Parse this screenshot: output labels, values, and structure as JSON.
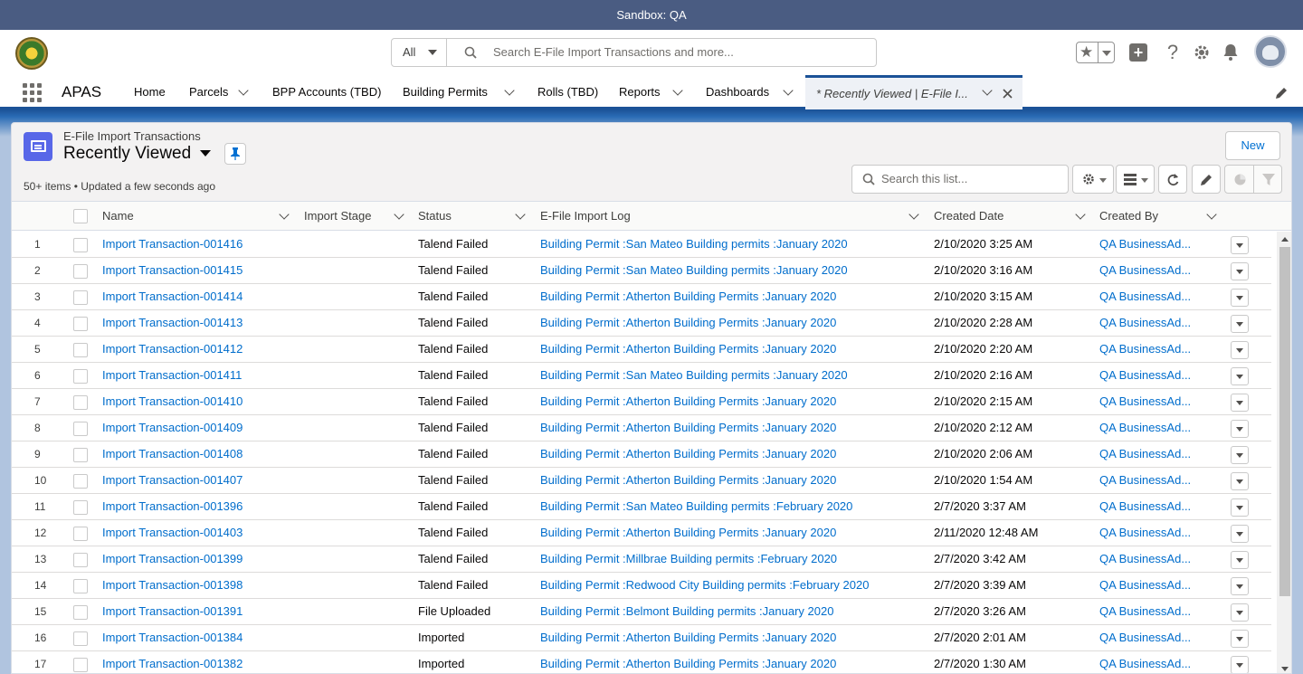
{
  "sandbox": {
    "label": "Sandbox: QA"
  },
  "header": {
    "search_scope": "All",
    "search_placeholder": "Search E-File Import Transactions and more..."
  },
  "nav": {
    "app_name": "APAS",
    "items": [
      {
        "label": "Home"
      },
      {
        "label": "Parcels"
      },
      {
        "label": "BPP Accounts (TBD)"
      },
      {
        "label": "Building Permits"
      },
      {
        "label": "Rolls (TBD)"
      },
      {
        "label": "Reports"
      },
      {
        "label": "Dashboards"
      }
    ],
    "active_tab": "* Recently Viewed | E-File I..."
  },
  "list": {
    "object_label": "E-File Import Transactions",
    "title": "Recently Viewed",
    "count_info": "50+ items • Updated a few seconds ago",
    "new_button": "New",
    "search_placeholder": "Search this list..."
  },
  "columns": {
    "name": "Name",
    "import_stage": "Import Stage",
    "status": "Status",
    "log": "E-File Import Log",
    "created_date": "Created Date",
    "created_by": "Created By"
  },
  "rows": [
    {
      "num": "1",
      "name": "Import Transaction-001416",
      "status": "Talend Failed",
      "log": "Building Permit :San Mateo Building permits :January 2020",
      "date": "2/10/2020 3:25 AM",
      "by": "QA BusinessAd..."
    },
    {
      "num": "2",
      "name": "Import Transaction-001415",
      "status": "Talend Failed",
      "log": "Building Permit :San Mateo Building permits :January 2020",
      "date": "2/10/2020 3:16 AM",
      "by": "QA BusinessAd..."
    },
    {
      "num": "3",
      "name": "Import Transaction-001414",
      "status": "Talend Failed",
      "log": "Building Permit :Atherton Building Permits :January 2020",
      "date": "2/10/2020 3:15 AM",
      "by": "QA BusinessAd..."
    },
    {
      "num": "4",
      "name": "Import Transaction-001413",
      "status": "Talend Failed",
      "log": "Building Permit :Atherton Building Permits :January 2020",
      "date": "2/10/2020 2:28 AM",
      "by": "QA BusinessAd..."
    },
    {
      "num": "5",
      "name": "Import Transaction-001412",
      "status": "Talend Failed",
      "log": "Building Permit :Atherton Building Permits :January 2020",
      "date": "2/10/2020 2:20 AM",
      "by": "QA BusinessAd..."
    },
    {
      "num": "6",
      "name": "Import Transaction-001411",
      "status": "Talend Failed",
      "log": "Building Permit :San Mateo Building permits :January 2020",
      "date": "2/10/2020 2:16 AM",
      "by": "QA BusinessAd..."
    },
    {
      "num": "7",
      "name": "Import Transaction-001410",
      "status": "Talend Failed",
      "log": "Building Permit :Atherton Building Permits :January 2020",
      "date": "2/10/2020 2:15 AM",
      "by": "QA BusinessAd..."
    },
    {
      "num": "8",
      "name": "Import Transaction-001409",
      "status": "Talend Failed",
      "log": "Building Permit :Atherton Building Permits :January 2020",
      "date": "2/10/2020 2:12 AM",
      "by": "QA BusinessAd..."
    },
    {
      "num": "9",
      "name": "Import Transaction-001408",
      "status": "Talend Failed",
      "log": "Building Permit :Atherton Building Permits :January 2020",
      "date": "2/10/2020 2:06 AM",
      "by": "QA BusinessAd..."
    },
    {
      "num": "10",
      "name": "Import Transaction-001407",
      "status": "Talend Failed",
      "log": "Building Permit :Atherton Building Permits :January 2020",
      "date": "2/10/2020 1:54 AM",
      "by": "QA BusinessAd..."
    },
    {
      "num": "11",
      "name": "Import Transaction-001396",
      "status": "Talend Failed",
      "log": "Building Permit :San Mateo Building permits :February 2020",
      "date": "2/7/2020 3:37 AM",
      "by": "QA BusinessAd..."
    },
    {
      "num": "12",
      "name": "Import Transaction-001403",
      "status": "Talend Failed",
      "log": "Building Permit :Atherton Building Permits :January 2020",
      "date": "2/11/2020 12:48 AM",
      "by": "QA BusinessAd..."
    },
    {
      "num": "13",
      "name": "Import Transaction-001399",
      "status": "Talend Failed",
      "log": "Building Permit :Millbrae Building permits :February 2020",
      "date": "2/7/2020 3:42 AM",
      "by": "QA BusinessAd..."
    },
    {
      "num": "14",
      "name": "Import Transaction-001398",
      "status": "Talend Failed",
      "log": "Building Permit :Redwood City Building permits :February 2020",
      "date": "2/7/2020 3:39 AM",
      "by": "QA BusinessAd..."
    },
    {
      "num": "15",
      "name": "Import Transaction-001391",
      "status": "File Uploaded",
      "log": "Building Permit :Belmont Building permits :January 2020",
      "date": "2/7/2020 3:26 AM",
      "by": "QA BusinessAd..."
    },
    {
      "num": "16",
      "name": "Import Transaction-001384",
      "status": "Imported",
      "log": "Building Permit :Atherton Building Permits :January 2020",
      "date": "2/7/2020 2:01 AM",
      "by": "QA BusinessAd..."
    },
    {
      "num": "17",
      "name": "Import Transaction-001382",
      "status": "Imported",
      "log": "Building Permit :Atherton Building Permits :January 2020",
      "date": "2/7/2020 1:30 AM",
      "by": "QA BusinessAd..."
    }
  ]
}
